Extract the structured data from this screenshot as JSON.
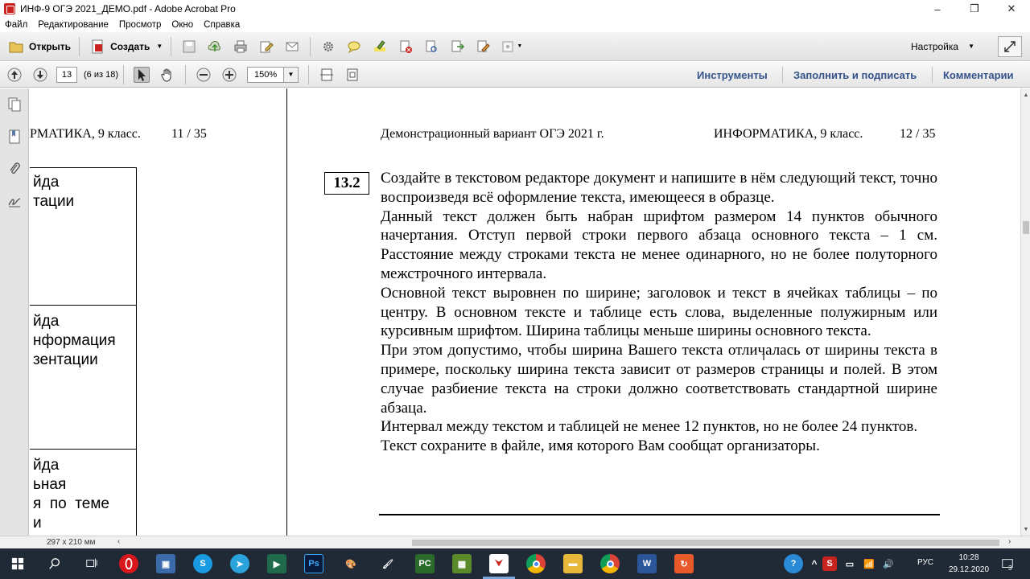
{
  "window": {
    "title": "ИНФ-9 ОГЭ 2021_ДЕМО.pdf - Adobe Acrobat Pro",
    "minimize": "–",
    "restore": "❐",
    "close": "✕"
  },
  "menu": [
    "Файл",
    "Редактирование",
    "Просмотр",
    "Окно",
    "Справка"
  ],
  "toolbar1": {
    "open_label": "Открыть",
    "create_label": "Создать",
    "customize_label": "Настройка"
  },
  "toolbar2": {
    "page_number": "13",
    "page_count": "(6 из 18)",
    "zoom": "150%",
    "tabs": {
      "tools": "Инструменты",
      "fill_sign": "Заполнить и подписать",
      "comments": "Комментарии"
    }
  },
  "left_page": {
    "header": "РМАТИКА, 9 класс.",
    "page": "11 / 35",
    "cells": [
      "йда\nтации",
      "йда\nнформация\nзентации",
      "йда\nьная\nя  по  теме\nи"
    ]
  },
  "right_page": {
    "header_left": "Демонстрационный вариант ОГЭ 2021 г.",
    "header_subject": "ИНФОРМАТИКА, 9 класс.",
    "header_page": "12 / 35",
    "task_number": "13.2",
    "paragraphs": [
      "Создайте в текстовом редакторе документ и напишите в нём следующий текст, точно воспроизведя всё оформление текста, имеющееся в образце.",
      "Данный текст должен быть набран шрифтом размером 14 пунктов обычного начертания. Отступ первой строки первого абзаца основного текста – 1 см. Расстояние между строками текста не менее одинарного, но не более полуторного межстрочного интервала.",
      "Основной текст выровнен по ширине; заголовок и текст в ячейках таблицы – по центру. В основном тексте и таблице есть слова, выделенные полужирным или курсивным шрифтом. Ширина таблицы меньше ширины основного текста.",
      "При этом допустимо, чтобы ширина Вашего текста отличалась от ширины текста в примере, поскольку ширина текста зависит от размеров страницы и полей. В этом случае разбиение текста на строки должно соответствовать стандартной ширине абзаца.",
      "Интервал между текстом и таблицей не менее 12 пунктов, но не более 24 пунктов.",
      "Текст сохраните в файле, имя которого Вам сообщат организаторы."
    ]
  },
  "status": {
    "page_size": "297 x 210 мм"
  },
  "taskbar": {
    "language": "РУС",
    "time": "10:28",
    "date": "29.12.2020",
    "notifications": "3"
  },
  "colors": {
    "tab_text": "#34528a",
    "taskbar_bg": "#1f2a36",
    "acrobat_red": "#c8231e"
  }
}
